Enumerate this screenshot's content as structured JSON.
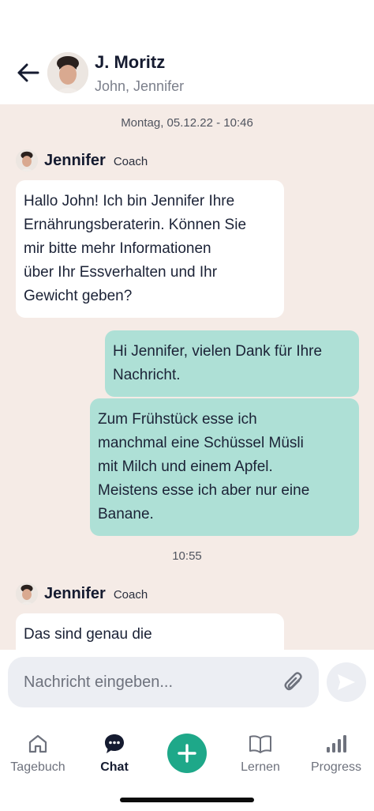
{
  "header": {
    "back_icon": "arrow-left-icon",
    "title": "J. Moritz",
    "subtitle": "John, Jennifer"
  },
  "chat": {
    "date_separator": "Montag, 05.12.22 - 10:46",
    "time_separator": "10:55",
    "sender_1": {
      "name": "Jennifer",
      "role": "Coach"
    },
    "sender_2": {
      "name": "Jennifer",
      "role": "Coach"
    },
    "messages": [
      {
        "direction": "incoming",
        "lines": [
          "Hallo John! Ich bin Jennifer Ihre",
          "Ernährungsberaterin. Können Sie",
          "mir bitte mehr Informationen",
          "über Ihr Essverhalten und Ihr",
          "Gewicht geben?"
        ]
      },
      {
        "direction": "outgoing",
        "lines": [
          "Hi Jennifer, vielen Dank für Ihre",
          "Nachricht."
        ]
      },
      {
        "direction": "outgoing",
        "lines": [
          "Zum Frühstück esse ich",
          "manchmal eine Schüssel Müsli",
          "mit Milch und einem Apfel.",
          "Meistens esse ich aber nur eine",
          "Banane."
        ]
      },
      {
        "direction": "incoming",
        "lines": [
          "Das sind genau die"
        ]
      }
    ]
  },
  "composer": {
    "placeholder": "Nachricht eingeben...",
    "attach_icon": "paperclip-icon",
    "send_icon": "send-icon"
  },
  "tabbar": {
    "tabs": [
      {
        "label": "Tagebuch",
        "icon": "home-icon"
      },
      {
        "label": "Chat",
        "icon": "chat-bubble-icon",
        "active": true
      },
      {
        "label": "Lernen",
        "icon": "book-icon"
      },
      {
        "label": "Progress",
        "icon": "bar-chart-icon"
      }
    ],
    "add_icon": "plus-icon"
  },
  "colors": {
    "chat_background": "#f5ebe6",
    "outgoing_bubble": "#aee0d6",
    "incoming_bubble": "#ffffff",
    "accent": "#1ea889",
    "text_primary": "#151b30"
  }
}
